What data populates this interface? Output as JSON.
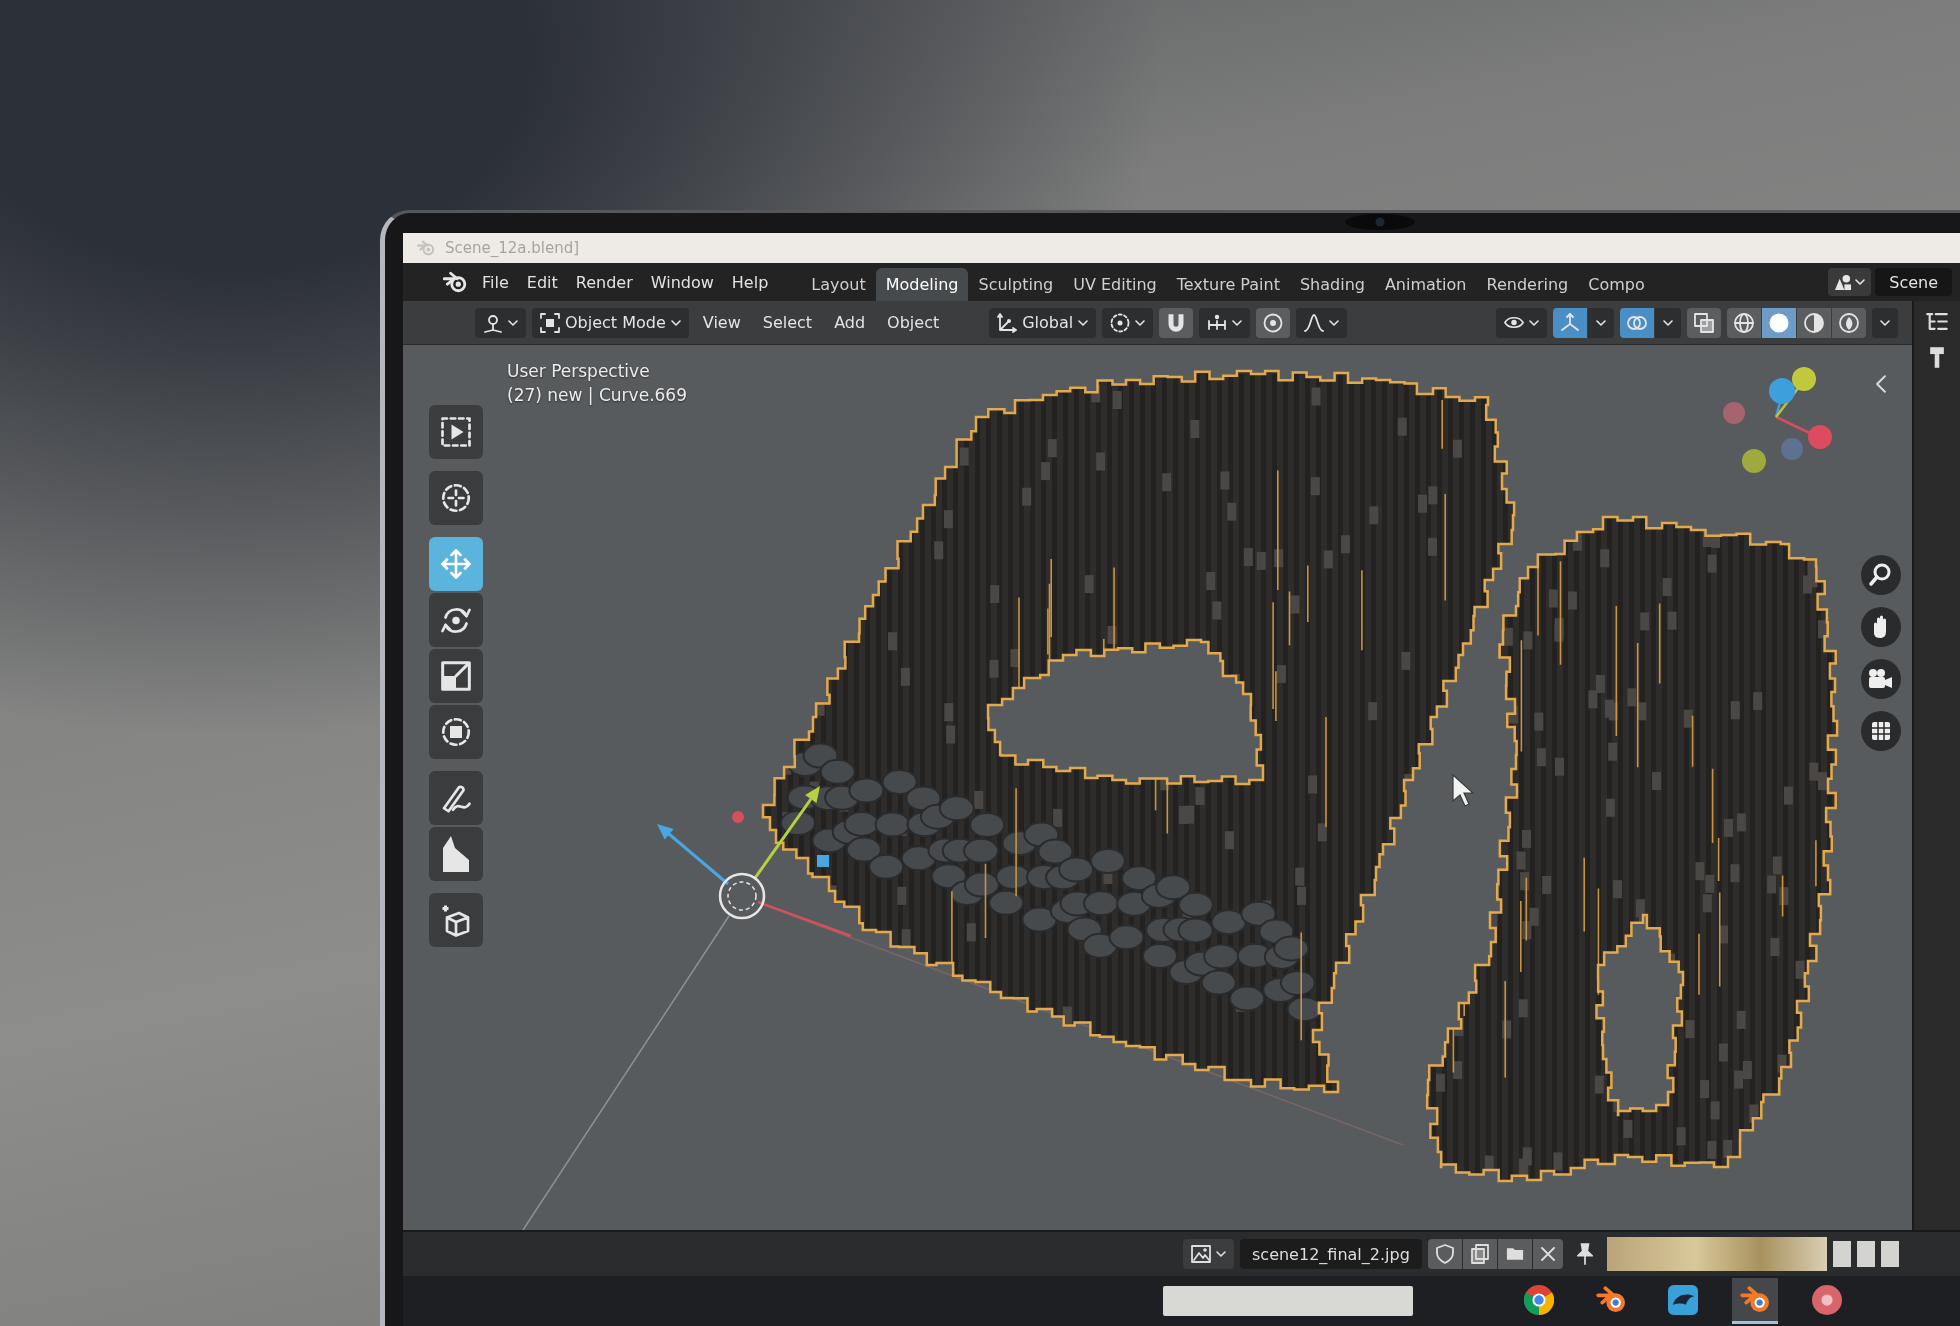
{
  "window": {
    "title": "Scene_12a.blend]"
  },
  "menu": [
    "File",
    "Edit",
    "Render",
    "Window",
    "Help"
  ],
  "workspaces": [
    {
      "label": "Layout",
      "selected": false
    },
    {
      "label": "Modeling",
      "selected": true
    },
    {
      "label": "Sculpting",
      "selected": false
    },
    {
      "label": "UV Editing",
      "selected": false
    },
    {
      "label": "Texture Paint",
      "selected": false
    },
    {
      "label": "Shading",
      "selected": false
    },
    {
      "label": "Animation",
      "selected": false
    },
    {
      "label": "Rendering",
      "selected": false
    },
    {
      "label": "Compo",
      "selected": false
    }
  ],
  "scene": {
    "name": "Scene"
  },
  "viewport_header": {
    "mode": "Object Mode",
    "menus": [
      "View",
      "Select",
      "Add",
      "Object"
    ],
    "orientation": "Global",
    "snap_on": false,
    "proportional_on": false,
    "gizmos_on": true,
    "overlays_on": true,
    "xray_on": false,
    "shading": [
      {
        "kind": "wireframe",
        "selected": false
      },
      {
        "kind": "solid",
        "selected": true
      },
      {
        "kind": "material",
        "selected": false
      },
      {
        "kind": "rendered",
        "selected": false
      }
    ]
  },
  "viewport": {
    "view_name": "User Perspective",
    "object_info": "(27) new | Curve.669"
  },
  "tools": [
    {
      "kind": "select_box",
      "selected": false
    },
    {
      "kind": "cursor",
      "selected": false
    },
    {
      "kind": "move",
      "selected": true
    },
    {
      "kind": "rotate",
      "selected": false
    },
    {
      "kind": "scale",
      "selected": false
    },
    {
      "kind": "transform",
      "selected": false
    },
    {
      "kind": "annotate",
      "selected": false
    },
    {
      "kind": "measure",
      "selected": false
    },
    {
      "kind": "add_cube",
      "selected": false
    }
  ],
  "image_editor": {
    "filename": "scene12_final_2.jpg"
  },
  "taskbar": [
    {
      "kind": "browser",
      "active": false
    },
    {
      "kind": "blender",
      "active": false
    },
    {
      "kind": "blue_app",
      "active": false
    },
    {
      "kind": "blender",
      "active": true
    },
    {
      "kind": "red_app",
      "active": false
    }
  ]
}
